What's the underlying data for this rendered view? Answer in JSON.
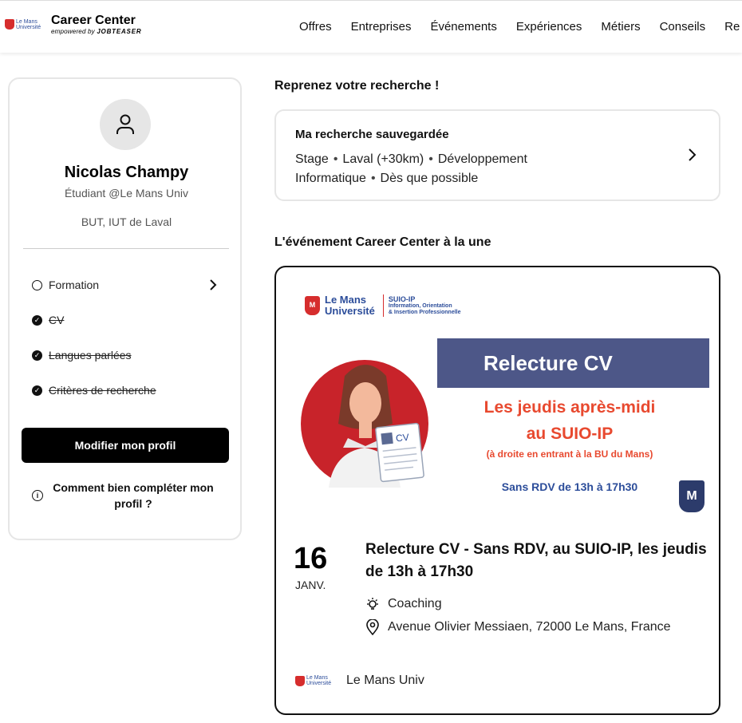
{
  "header": {
    "logo_text": "Le Mans Université",
    "title": "Career Center",
    "subtitle_prefix": "empowered by",
    "subtitle_brand": "JOBTEASER",
    "nav": [
      "Offres",
      "Entreprises",
      "Événements",
      "Expériences",
      "Métiers",
      "Conseils",
      "Re"
    ]
  },
  "profile": {
    "name": "Nicolas Champy",
    "role": "Étudiant @Le Mans Univ",
    "school": "BUT, IUT de Laval",
    "checklist": [
      {
        "label": "Formation",
        "done": false
      },
      {
        "label": "CV",
        "done": true
      },
      {
        "label": "Langues parlées",
        "done": true
      },
      {
        "label": "Critères de recherche",
        "done": true
      }
    ],
    "edit_button": "Modifier mon profil",
    "help_text": "Comment bien compléter mon profil ?"
  },
  "search_section": {
    "heading": "Reprenez votre recherche !",
    "card_title": "Ma recherche sauvegardée",
    "tags": [
      "Stage",
      "Laval (+30km)",
      "Développement Informatique",
      "Dès que possible"
    ]
  },
  "event_section": {
    "heading": "L'événement Career Center à la une",
    "image": {
      "logo_name": "Le Mans Université",
      "logo_name_line1": "Le Mans",
      "logo_name_line2": "Université",
      "service": "SUIO-IP",
      "service_line1": "Information, Orientation",
      "service_line2": "& Insertion Professionnelle",
      "banner": "Relecture CV",
      "line1": "Les jeudis après-midi",
      "line2": "au SUIO-IP",
      "line3": "(à droite en entrant à la BU du Mans)",
      "line4": "Sans RDV de 13h à 17h30",
      "cv_label": "CV",
      "badge": "M"
    },
    "day": "16",
    "month": "JANV.",
    "title": "Relecture CV - Sans RDV, au SUIO-IP, les jeudis de 13h à 17h30",
    "category": "Coaching",
    "address": "Avenue Olivier Messiaen, 72000 Le Mans, France",
    "organizer": "Le Mans Univ"
  }
}
